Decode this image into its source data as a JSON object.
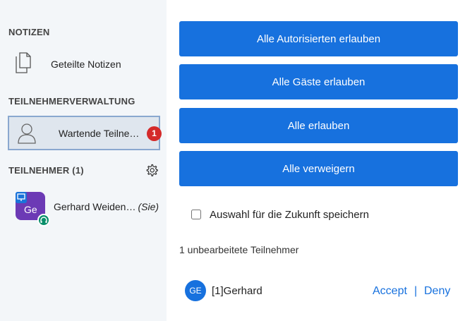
{
  "sidebar": {
    "notes_title": "NOTIZEN",
    "notes_item": {
      "label": "Geteilte Notizen",
      "icon": "shared-notes-icon"
    },
    "management_title": "TEILNEHMERVERWALTUNG",
    "waiting_item": {
      "label": "Wartende Teilne…",
      "badge": "1",
      "icon": "user-icon"
    },
    "participants_title": "TEILNEHMER (1)",
    "settings_icon": "gear-icon",
    "participants": [
      {
        "initials": "Ge",
        "name": "Gerhard Weiden…",
        "you_label": "(Sie)",
        "avatar_color": "#6c3ab5",
        "presenter": true,
        "audio": true
      }
    ]
  },
  "main": {
    "buttons": {
      "allow_authenticated": "Alle Autorisierten erlauben",
      "allow_guests": "Alle Gäste erlauben",
      "allow_all": "Alle erlauben",
      "deny_all": "Alle verweigern"
    },
    "remember_choice": {
      "label": "Auswahl für die Zukunft speichern",
      "checked": false
    },
    "pending_count": "1 unbearbeitete Teilnehmer",
    "pending_users": [
      {
        "initials": "GE",
        "name": "[1]Gerhard",
        "accept": "Accept",
        "separator": "|",
        "deny": "Deny"
      }
    ]
  },
  "colors": {
    "primary": "#1771de",
    "sidebar_bg": "#f3f6f9",
    "badge": "#d42a2a",
    "selected_border": "#8aa8cf"
  }
}
